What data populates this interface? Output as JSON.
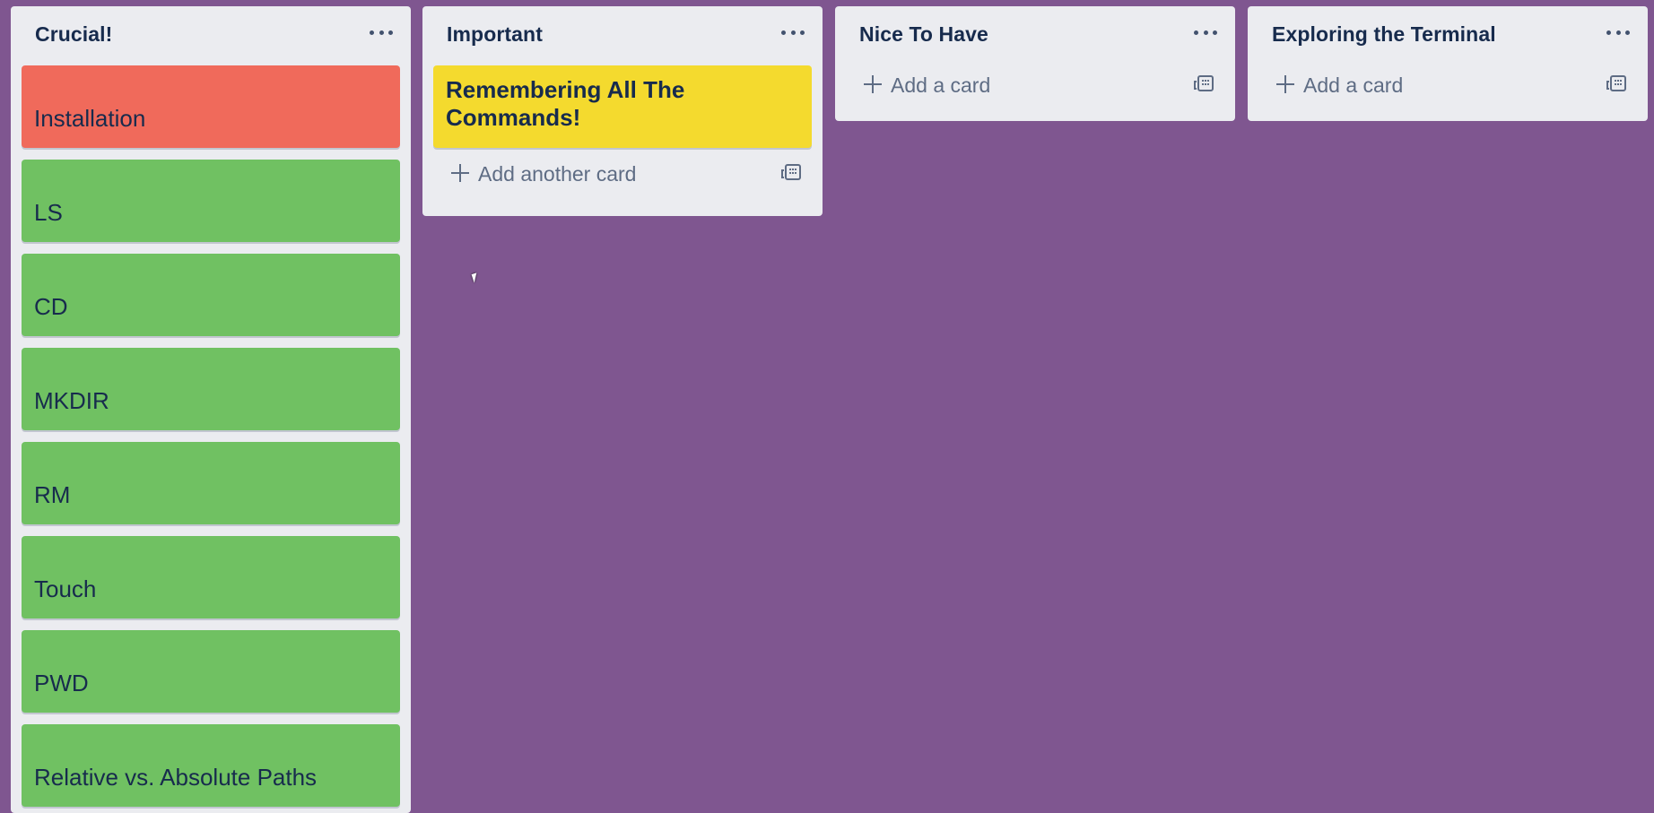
{
  "board": {
    "background_color": "#7f5690",
    "lists": [
      {
        "title": "Crucial!",
        "menu_icon": "ellipsis-icon",
        "cards": [
          {
            "title": "Installation",
            "color": "#f06a5b"
          },
          {
            "title": "LS",
            "color": "#70c162"
          },
          {
            "title": "CD",
            "color": "#70c162"
          },
          {
            "title": "MKDIR",
            "color": "#70c162"
          },
          {
            "title": "RM",
            "color": "#70c162"
          },
          {
            "title": "Touch",
            "color": "#70c162"
          },
          {
            "title": "PWD",
            "color": "#70c162"
          },
          {
            "title": "Relative vs. Absolute Paths",
            "color": "#70c162"
          }
        ]
      },
      {
        "title": "Important",
        "menu_icon": "ellipsis-icon",
        "cards": [
          {
            "title": "Remembering All The Commands!",
            "color": "#f4da2e"
          }
        ],
        "add_card_label": "Add another card",
        "template_icon": "card-template-icon"
      },
      {
        "title": "Nice To Have",
        "menu_icon": "ellipsis-icon",
        "cards": [],
        "add_card_label": "Add a card",
        "template_icon": "card-template-icon"
      },
      {
        "title": "Exploring the Terminal",
        "menu_icon": "ellipsis-icon",
        "cards": [],
        "add_card_label": "Add a card",
        "template_icon": "card-template-icon"
      }
    ]
  }
}
